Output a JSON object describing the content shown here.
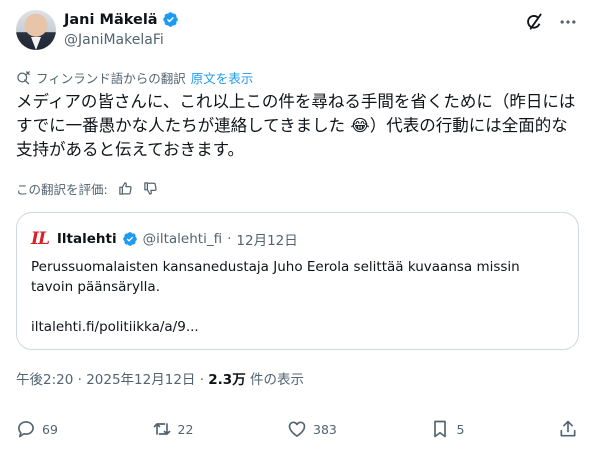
{
  "author": {
    "display_name": "Jani Mäkelä",
    "handle": "@JaniMakelaFi"
  },
  "header_icons": [
    "grok-icon",
    "more-icon"
  ],
  "translation": {
    "note": "フィンランド語からの翻訳",
    "show_original": "原文を表示"
  },
  "tweet": {
    "text": "メディアの皆さんに、これ以上この件を尋ねる手間を省くために（昨日にはすでに一番愚かな人たちが連絡してきました 😂）代表の行動には全面的な支持があると伝えておきます。"
  },
  "rating": {
    "label": "この翻訳を評価:"
  },
  "quote": {
    "logo": "IL",
    "name": "Iltalehti",
    "handle": "@iltalehti_fi",
    "separator": "·",
    "date": "12月12日",
    "text": "Perussuomalaisten kansanedustaja Juho Eerola selittää kuvaansa missin tavoin päänsärylla.",
    "link": "iltalehti.fi/politiikka/a/9..."
  },
  "meta": {
    "time": "午後2:20 · 2025年12月12日 · ",
    "views_count": "2.3万",
    "views_label": " 件の表示"
  },
  "actions": {
    "replies": "69",
    "reposts": "22",
    "likes": "383",
    "bookmarks": "5"
  },
  "colors": {
    "accent": "#1d9bf0",
    "secondary_text": "#536471",
    "border": "#cfd9de",
    "logo_red": "#d8222a"
  }
}
